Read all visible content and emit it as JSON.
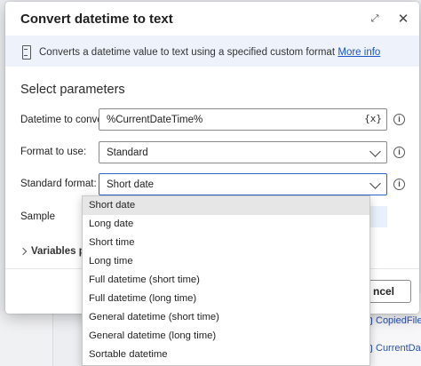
{
  "background": {
    "variables": [
      "CopiedFiles",
      "CurrentDate"
    ]
  },
  "dialog": {
    "title": "Convert datetime to text",
    "expand_icon": "expand-icon",
    "close_icon": "close-icon",
    "info_text": "Converts a datetime value to text using a specified custom format",
    "info_link": "More info",
    "section_title": "Select parameters",
    "fields": {
      "datetime_label": "Datetime to convert:",
      "datetime_value": "%CurrentDateTime%",
      "var_button": "{x}",
      "format_label": "Format to use:",
      "format_value": "Standard",
      "standard_label": "Standard format:",
      "standard_value": "Short date",
      "sample_label": "Sample"
    },
    "variables_toggle": "Variables prod",
    "cancel_label": "ncel"
  },
  "dropdown": {
    "options": [
      "Short date",
      "Long date",
      "Short time",
      "Long time",
      "Full datetime (short time)",
      "Full datetime (long time)",
      "General datetime (short time)",
      "General datetime (long time)",
      "Sortable datetime"
    ],
    "selected_index": 0
  },
  "colors": {
    "accent": "#2b66cc",
    "link": "#1a56c8",
    "info_bar": "#eef3fb"
  }
}
